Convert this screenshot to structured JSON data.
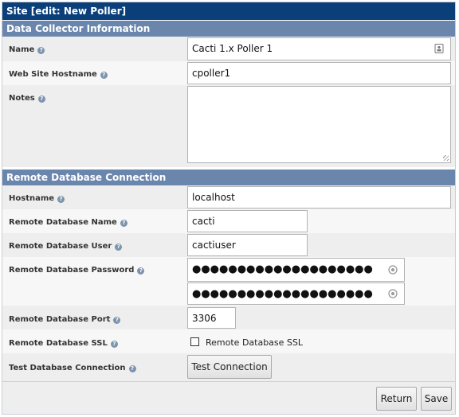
{
  "title": "Site [edit: New Poller]",
  "sections": {
    "collector": {
      "heading": "Data Collector Information"
    },
    "remote": {
      "heading": "Remote Database Connection"
    }
  },
  "fields": {
    "name": {
      "label": "Name",
      "value": "Cacti 1.x Poller 1"
    },
    "hostname": {
      "label": "Web Site Hostname",
      "value": "cpoller1"
    },
    "notes": {
      "label": "Notes",
      "value": ""
    },
    "db_hostname": {
      "label": "Hostname",
      "value": "localhost"
    },
    "db_name": {
      "label": "Remote Database Name",
      "value": "cacti"
    },
    "db_user": {
      "label": "Remote Database User",
      "value": "cactiuser"
    },
    "db_password": {
      "label": "Remote Database Password",
      "value": "●●●●●●●●●●●●●●●●●●●●",
      "confirm": "●●●●●●●●●●●●●●●●●●●●"
    },
    "db_port": {
      "label": "Remote Database Port",
      "value": "3306"
    },
    "db_ssl": {
      "label": "Remote Database SSL",
      "checkbox_label": "Remote Database SSL",
      "checked": false
    },
    "test_conn": {
      "label": "Test Database Connection",
      "button_label": "Test Connection"
    }
  },
  "footer": {
    "return_label": "Return",
    "save_label": "Save"
  },
  "icons": {
    "help": "help-icon",
    "contact": "contact-card-icon",
    "password_toggle": "password-reveal-icon"
  },
  "colors": {
    "title_bar": "#0b3f7a",
    "section_header": "#6b86ad"
  }
}
